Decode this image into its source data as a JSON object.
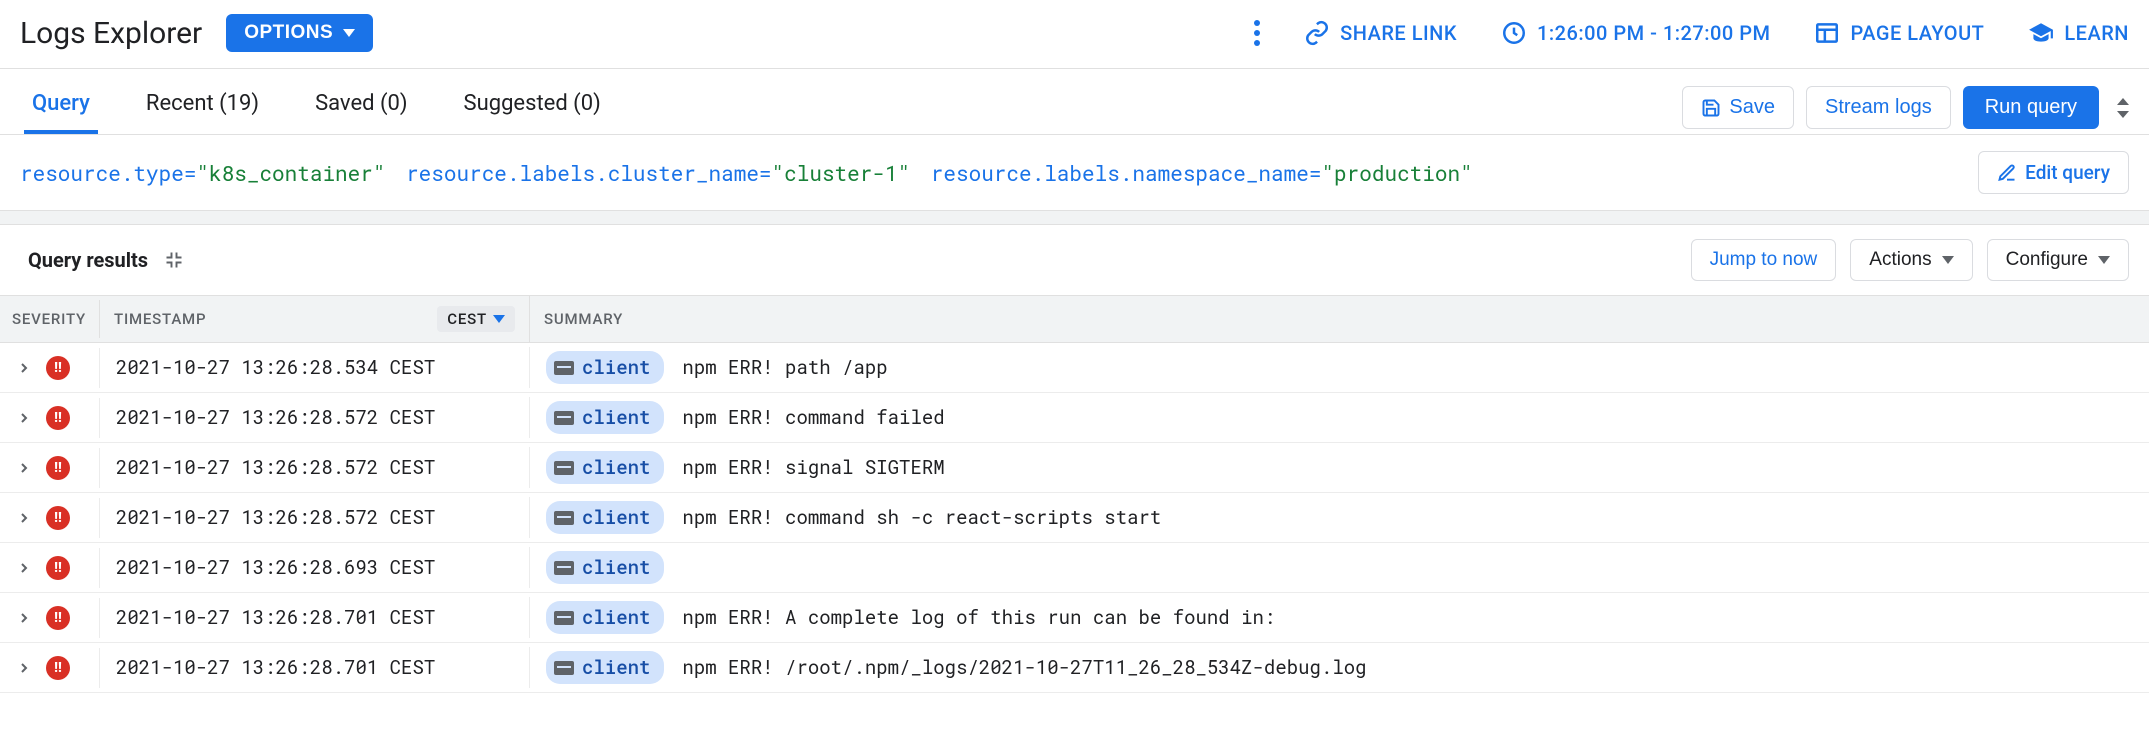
{
  "header": {
    "title": "Logs Explorer",
    "options_label": "OPTIONS",
    "share_label": "SHARE LINK",
    "time_range": "1:26:00 PM - 1:27:00 PM",
    "layout_label": "PAGE LAYOUT",
    "learn_label": "LEARN"
  },
  "tabs": {
    "query": "Query",
    "recent": "Recent (19)",
    "saved": "Saved (0)",
    "suggested": "Suggested (0)",
    "save_btn": "Save",
    "stream_btn": "Stream logs",
    "run_btn": "Run query"
  },
  "query": {
    "tokens": [
      {
        "key": "resource.type=",
        "str": "\"k8s_container\""
      },
      {
        "key": "resource.labels.cluster_name=",
        "str": "\"cluster-1\""
      },
      {
        "key": "resource.labels.namespace_name=",
        "str": "\"production\""
      }
    ],
    "edit_label": "Edit query"
  },
  "results": {
    "title": "Query results",
    "jump_label": "Jump to now",
    "actions_label": "Actions",
    "configure_label": "Configure"
  },
  "table": {
    "headers": {
      "severity": "SEVERITY",
      "timestamp": "TIMESTAMP",
      "summary": "SUMMARY"
    },
    "tz": "CEST",
    "source_chip": "client",
    "rows": [
      {
        "ts": "2021-10-27 13:26:28.534 CEST",
        "msg": "npm ERR! path /app"
      },
      {
        "ts": "2021-10-27 13:26:28.572 CEST",
        "msg": "npm ERR! command failed"
      },
      {
        "ts": "2021-10-27 13:26:28.572 CEST",
        "msg": "npm ERR! signal SIGTERM"
      },
      {
        "ts": "2021-10-27 13:26:28.572 CEST",
        "msg": "npm ERR! command sh -c react-scripts start"
      },
      {
        "ts": "2021-10-27 13:26:28.693 CEST",
        "msg": ""
      },
      {
        "ts": "2021-10-27 13:26:28.701 CEST",
        "msg": "npm ERR! A complete log of this run can be found in:"
      },
      {
        "ts": "2021-10-27 13:26:28.701 CEST",
        "msg": "npm ERR! /root/.npm/_logs/2021-10-27T11_26_28_534Z-debug.log"
      }
    ]
  }
}
